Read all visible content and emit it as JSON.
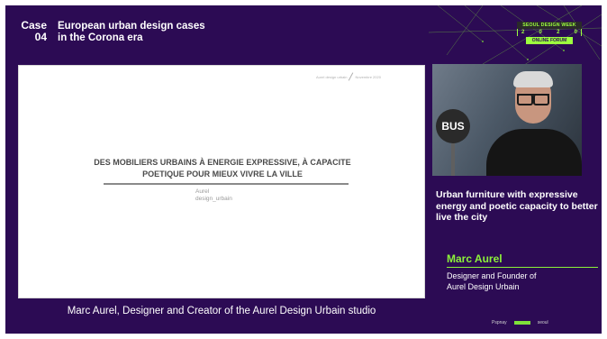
{
  "header": {
    "case_label_line1": "Case",
    "case_label_line2": "04",
    "title_line1": "European urban design cases",
    "title_line2": "in the Corona era"
  },
  "badge": {
    "top": "SEOUL DESIGN WEEK",
    "year_digits": [
      "2",
      "0",
      "2",
      "0"
    ],
    "bottom": "ONLINE FORUM"
  },
  "slide": {
    "header_left": "Aurel design urbain",
    "header_right": "Novembre 2020",
    "title": "DES MOBILIERS URBAINS À ENERGIE EXPRESSIVE, À CAPACITE POETIQUE POUR MIEUX VIVRE LA VILLE",
    "author_line1": "Aurel",
    "author_line2": "design_urbain"
  },
  "video": {
    "stop_sign_text": "BUS"
  },
  "topic": "Urban furniture with expressive energy and poetic capacity to better live the city",
  "speaker": {
    "name": "Marc Aurel",
    "role_line1": "Designer and Founder of",
    "role_line2": "Aurel Design Urbain"
  },
  "caption": "Marc Aurel, Designer and Creator of the Aurel Design Urbain studio",
  "footer": {
    "logo1": "Pspnay",
    "logo2": "seoul"
  },
  "colors": {
    "background": "#2c0b54",
    "accent": "#8cf23a"
  }
}
